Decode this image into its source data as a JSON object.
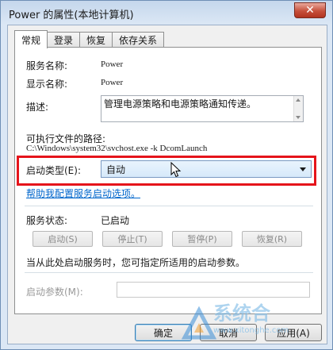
{
  "window": {
    "title": "Power 的属性(本地计算机)",
    "close_label": "✕"
  },
  "tabs": [
    {
      "label": "常规",
      "active": true
    },
    {
      "label": "登录",
      "active": false
    },
    {
      "label": "恢复",
      "active": false
    },
    {
      "label": "依存关系",
      "active": false
    }
  ],
  "general": {
    "service_name_label": "服务名称:",
    "service_name_value": "Power",
    "display_name_label": "显示名称:",
    "display_name_value": "Power",
    "description_label": "描述:",
    "description_value": "管理电源策略和电源策略通知传递。",
    "exec_path_label": "可执行文件的路径:",
    "exec_path_value": "C:\\Windows\\system32\\svchost.exe -k DcomLaunch",
    "startup_type_label": "启动类型(E):",
    "startup_type_value": "自动",
    "help_link": "帮助我配置服务启动选项。",
    "service_status_label": "服务状态:",
    "service_status_value": "已启动",
    "buttons": {
      "start": "启动(S)",
      "stop": "停止(T)",
      "pause": "暂停(P)",
      "resume": "恢复(R)"
    },
    "hint_text": "当从此处启动服务时，您可指定所适用的启动参数。",
    "start_params_label": "启动参数(M):",
    "start_params_value": ""
  },
  "dialog_buttons": {
    "ok": "确定",
    "cancel": "取消",
    "apply": "应用(A)"
  },
  "watermark": {
    "text": "系统合",
    "url": "www.xitonghe.com"
  },
  "colors": {
    "highlight_border": "#e5141b",
    "link": "#0066cc",
    "close_button": "#c6503b"
  }
}
